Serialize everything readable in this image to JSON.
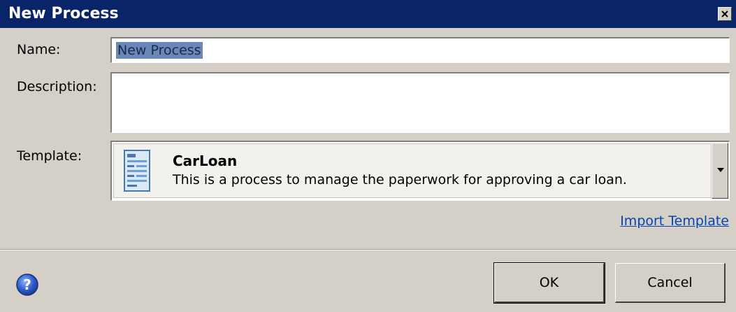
{
  "window": {
    "title": "New Process"
  },
  "form": {
    "name_label": "Name:",
    "name_value": "New Process",
    "description_label": "Description:",
    "description_value": "",
    "template_label": "Template:"
  },
  "template": {
    "name": "CarLoan",
    "description": "This is a process to manage the paperwork for approving a car loan."
  },
  "links": {
    "import_template": "Import Template"
  },
  "buttons": {
    "ok": "OK",
    "cancel": "Cancel"
  },
  "colors": {
    "title_bar": "#0a246a",
    "dialog_bg": "#d4d0c8",
    "link": "#0645ad",
    "selection": "#6a87b8"
  },
  "icons": {
    "close": "close-icon",
    "template": "document-form-icon",
    "dropdown": "chevron-down-icon",
    "help": "help-icon"
  }
}
